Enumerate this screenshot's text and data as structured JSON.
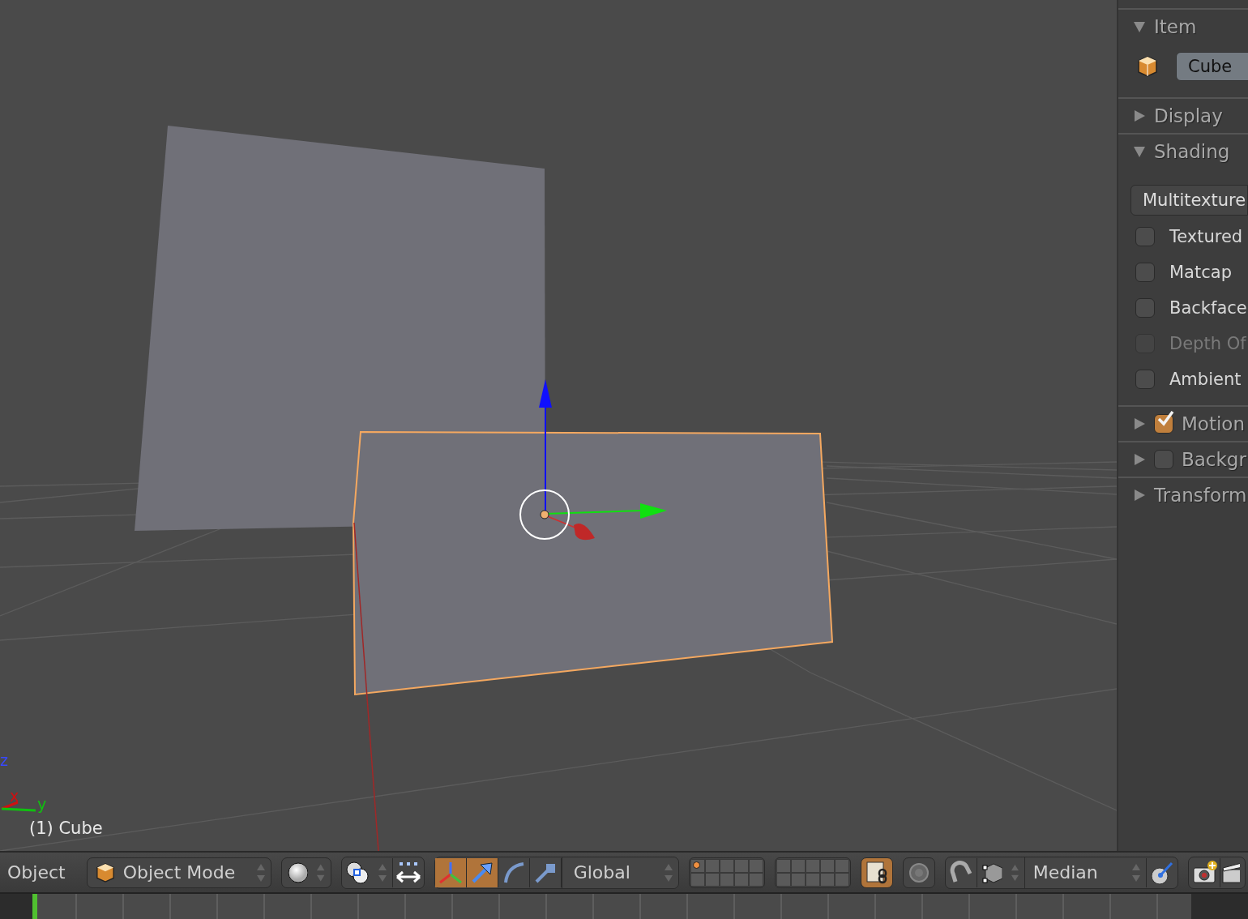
{
  "viewport": {
    "axes": [
      {
        "label": "z",
        "color": "#3848ff"
      },
      {
        "label": "x",
        "color": "#d01010"
      },
      {
        "label": "y",
        "color": "#10c010"
      }
    ],
    "object_info": "(1) Cube"
  },
  "properties": {
    "panels": [
      {
        "title": "Item",
        "expanded": true,
        "name_field": "Cube"
      },
      {
        "title": "Display",
        "expanded": false
      },
      {
        "title": "Shading",
        "expanded": true,
        "dropdown": "Multitexture",
        "options": [
          {
            "label": "Textured",
            "checked": false,
            "disabled": false
          },
          {
            "label": "Matcap",
            "checked": false,
            "disabled": false
          },
          {
            "label": "Backface",
            "checked": false,
            "disabled": false
          },
          {
            "label": "Depth Of",
            "checked": false,
            "disabled": true
          },
          {
            "label": "Ambient",
            "checked": false,
            "disabled": false
          }
        ]
      },
      {
        "title": "Motion",
        "expanded": false,
        "checked": true
      },
      {
        "title": "Backgr",
        "expanded": false,
        "checked": false
      },
      {
        "title": "Transform",
        "expanded": false
      }
    ]
  },
  "header": {
    "menu": "Object",
    "mode": "Object Mode",
    "transform_tools": [
      {
        "kind": "axes",
        "selected": true
      },
      {
        "kind": "arrow",
        "selected": true
      },
      {
        "kind": "arc",
        "selected": false
      },
      {
        "kind": "scale",
        "selected": false
      }
    ],
    "orientation": "Global",
    "lock_layers": {
      "on": true
    },
    "snap": {
      "on": false
    },
    "pivot": "Median"
  }
}
